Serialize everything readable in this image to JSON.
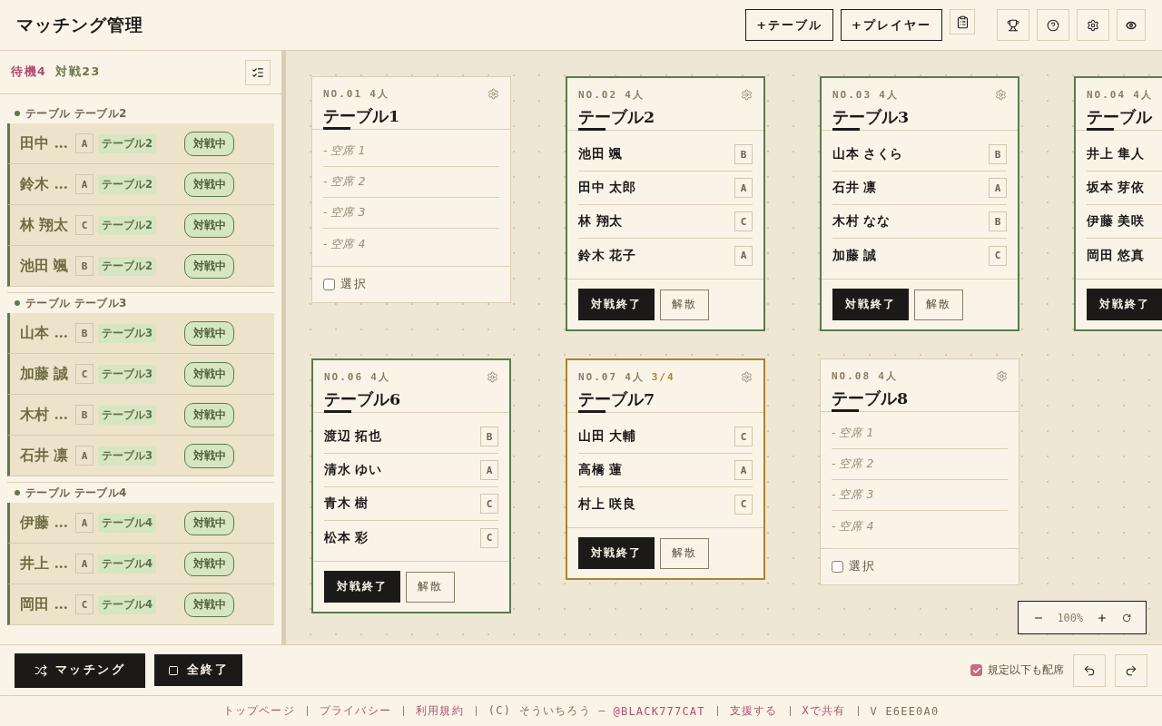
{
  "header": {
    "title": "マッチング管理",
    "buttons": [
      {
        "label": "+テーブル"
      },
      {
        "label": "+プレイヤー"
      }
    ]
  },
  "sidebar": {
    "counts": [
      {
        "kind": "waiting",
        "label": "待機4"
      },
      {
        "kind": "playing",
        "label": "対戦23"
      }
    ],
    "groups": [
      {
        "title": "テーブル テーブル2",
        "players": [
          {
            "name": "田中 …",
            "rank": "A",
            "table": "テーブル2",
            "status": "対戦中"
          },
          {
            "name": "鈴木 …",
            "rank": "A",
            "table": "テーブル2",
            "status": "対戦中"
          },
          {
            "name": "林 翔太",
            "rank": "C",
            "table": "テーブル2",
            "status": "対戦中"
          },
          {
            "name": "池田 颯",
            "rank": "B",
            "table": "テーブル2",
            "status": "対戦中"
          }
        ]
      },
      {
        "title": "テーブル テーブル3",
        "players": [
          {
            "name": "山本 …",
            "rank": "B",
            "table": "テーブル3",
            "status": "対戦中"
          },
          {
            "name": "加藤 誠",
            "rank": "C",
            "table": "テーブル3",
            "status": "対戦中"
          },
          {
            "name": "木村 …",
            "rank": "B",
            "table": "テーブル3",
            "status": "対戦中"
          },
          {
            "name": "石井 凛",
            "rank": "A",
            "table": "テーブル3",
            "status": "対戦中"
          }
        ]
      },
      {
        "title": "テーブル テーブル4",
        "players": [
          {
            "name": "伊藤 …",
            "rank": "A",
            "table": "テーブル4",
            "status": "対戦中"
          },
          {
            "name": "井上 …",
            "rank": "A",
            "table": "テーブル4",
            "status": "対戦中"
          },
          {
            "name": "岡田 …",
            "rank": "C",
            "table": "テーブル4",
            "status": "対戦中"
          }
        ]
      }
    ]
  },
  "cards": [
    {
      "number": "NO.01",
      "capacity": "4人",
      "kind": "empty",
      "title": "テーブル1",
      "seats": [
        {
          "kind": "empty",
          "label": "- 空席 1"
        },
        {
          "kind": "empty",
          "label": "- 空席 2"
        },
        {
          "kind": "empty",
          "label": "- 空席 3"
        },
        {
          "kind": "empty",
          "label": "- 空席 4"
        }
      ],
      "select": {
        "label": "選択",
        "checked": false
      }
    },
    {
      "number": "NO.02",
      "capacity": "4人",
      "kind": "full",
      "title": "テーブル2",
      "seats": [
        {
          "kind": "player",
          "name": "池田 颯",
          "rank": "B"
        },
        {
          "kind": "player",
          "name": "田中 太郎",
          "rank": "A"
        },
        {
          "kind": "player",
          "name": "林 翔太",
          "rank": "C"
        },
        {
          "kind": "player",
          "name": "鈴木 花子",
          "rank": "A"
        }
      ],
      "actions": [
        {
          "kind": "primary",
          "label": "対戦終了"
        },
        {
          "kind": "secondary",
          "label": "解散"
        }
      ]
    },
    {
      "number": "NO.03",
      "capacity": "4人",
      "kind": "full",
      "title": "テーブル3",
      "seats": [
        {
          "kind": "player",
          "name": "山本 さくら",
          "rank": "B"
        },
        {
          "kind": "player",
          "name": "石井 凛",
          "rank": "A"
        },
        {
          "kind": "player",
          "name": "木村 なな",
          "rank": "B"
        },
        {
          "kind": "player",
          "name": "加藤 誠",
          "rank": "C"
        }
      ],
      "actions": [
        {
          "kind": "primary",
          "label": "対戦終了"
        },
        {
          "kind": "secondary",
          "label": "解散"
        }
      ]
    },
    {
      "number": "NO.04",
      "capacity": "4人",
      "kind": "full",
      "title": "テーブル",
      "seats": [
        {
          "kind": "player",
          "name": "井上 隼人"
        },
        {
          "kind": "player",
          "name": "坂本 芽依"
        },
        {
          "kind": "player",
          "name": "伊藤 美咲"
        },
        {
          "kind": "player",
          "name": "岡田 悠真"
        }
      ],
      "actions": [
        {
          "kind": "primary",
          "label": "対戦終了"
        }
      ]
    },
    {
      "number": "NO.06",
      "capacity": "4人",
      "kind": "full",
      "title": "テーブル6",
      "seats": [
        {
          "kind": "player",
          "name": "渡辺 拓也",
          "rank": "B"
        },
        {
          "kind": "player",
          "name": "清水 ゆい",
          "rank": "A"
        },
        {
          "kind": "player",
          "name": "青木 樹",
          "rank": "C"
        },
        {
          "kind": "player",
          "name": "松本 彩",
          "rank": "C"
        }
      ],
      "actions": [
        {
          "kind": "primary",
          "label": "対戦終了"
        },
        {
          "kind": "secondary",
          "label": "解散"
        }
      ]
    },
    {
      "number": "NO.07",
      "capacity": "4人",
      "count": "3/4",
      "kind": "partial",
      "title": "テーブル7",
      "seats": [
        {
          "kind": "player",
          "name": "山田 大輔",
          "rank": "C"
        },
        {
          "kind": "player",
          "name": "高橋 蓮",
          "rank": "A"
        },
        {
          "kind": "player",
          "name": "村上 咲良",
          "rank": "C"
        }
      ],
      "actions": [
        {
          "kind": "primary",
          "label": "対戦終了"
        },
        {
          "kind": "secondary",
          "label": "解散"
        }
      ]
    },
    {
      "number": "NO.08",
      "capacity": "4人",
      "kind": "empty",
      "title": "テーブル8",
      "seats": [
        {
          "kind": "empty",
          "label": "- 空席 1"
        },
        {
          "kind": "empty",
          "label": "- 空席 2"
        },
        {
          "kind": "empty",
          "label": "- 空席 3"
        },
        {
          "kind": "empty",
          "label": "- 空席 4"
        }
      ],
      "select": {
        "label": "選択",
        "checked": false
      }
    }
  ],
  "zoom": {
    "value": "100%"
  },
  "bottom_bar": {
    "buttons": [
      {
        "kind": "shuffle",
        "label": "マッチング"
      },
      {
        "kind": "square",
        "label": "全終了"
      }
    ],
    "option": {
      "label": "規定以下も配席",
      "checked": true
    }
  },
  "footer": {
    "items": [
      {
        "kind": "link",
        "text": "トップページ"
      },
      {
        "kind": "link",
        "text": "プライバシー"
      },
      {
        "kind": "link",
        "text": "利用規約"
      },
      {
        "kind": "credit",
        "text": "(C) そういちろう —",
        "link": "@BLACK777CAT"
      },
      {
        "kind": "link",
        "text": "支援する"
      },
      {
        "kind": "link",
        "text": "Xで共有"
      },
      {
        "kind": "version",
        "text": "V E6EE0A0"
      }
    ]
  }
}
